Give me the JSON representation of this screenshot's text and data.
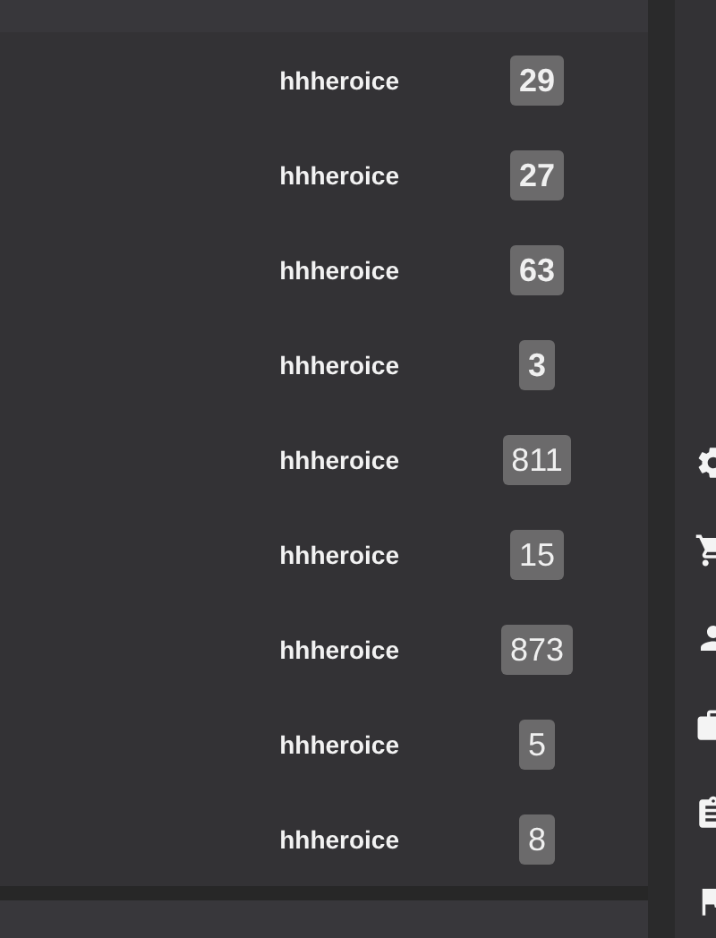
{
  "rows": [
    {
      "name": "hhheroice",
      "count": "29",
      "emphasized": true
    },
    {
      "name": "hhheroice",
      "count": "27",
      "emphasized": true
    },
    {
      "name": "hhheroice",
      "count": "63",
      "emphasized": true
    },
    {
      "name": "hhheroice",
      "count": "3",
      "emphasized": true
    },
    {
      "name": "hhheroice",
      "count": "811",
      "emphasized": false
    },
    {
      "name": "hhheroice",
      "count": "15",
      "emphasized": false
    },
    {
      "name": "hhheroice",
      "count": "873",
      "emphasized": false
    },
    {
      "name": "hhheroice",
      "count": "5",
      "emphasized": false
    },
    {
      "name": "hhheroice",
      "count": "8",
      "emphasized": false
    }
  ],
  "side_icons": [
    {
      "kind": "settings"
    },
    {
      "kind": "cart"
    },
    {
      "kind": "person"
    },
    {
      "kind": "briefcase"
    },
    {
      "kind": "clipboard"
    },
    {
      "kind": "flag"
    }
  ]
}
